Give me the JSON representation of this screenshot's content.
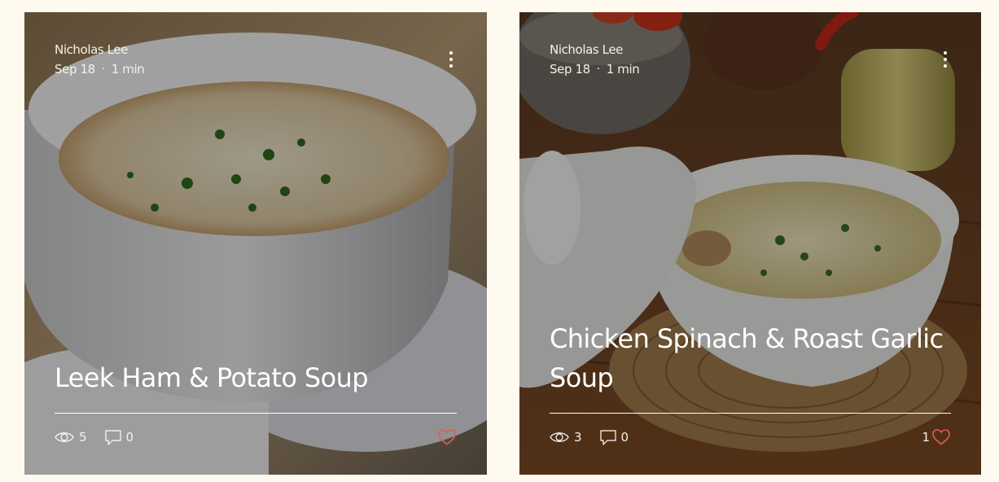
{
  "posts": [
    {
      "author": "Nicholas Lee",
      "date": "Sep 18",
      "separator": "·",
      "read_time": "1 min",
      "title": "Leek Ham & Potato Soup",
      "views": "5",
      "comments": "0",
      "likes": "",
      "like_color": "#e25b54",
      "icons": [
        "more-icon",
        "eye-icon",
        "comment-icon",
        "heart-icon"
      ]
    },
    {
      "author": "Nicholas Lee",
      "date": "Sep 18",
      "separator": "·",
      "read_time": "1 min",
      "title": "Chicken Spinach & Roast Garlic Soup",
      "views": "3",
      "comments": "0",
      "likes": "1",
      "like_color": "#e25b54",
      "icons": [
        "more-icon",
        "eye-icon",
        "comment-icon",
        "heart-icon"
      ]
    }
  ],
  "colors": {
    "page_background": "#fefaef",
    "card_text": "#ffffff",
    "heart": "#e25b54"
  }
}
